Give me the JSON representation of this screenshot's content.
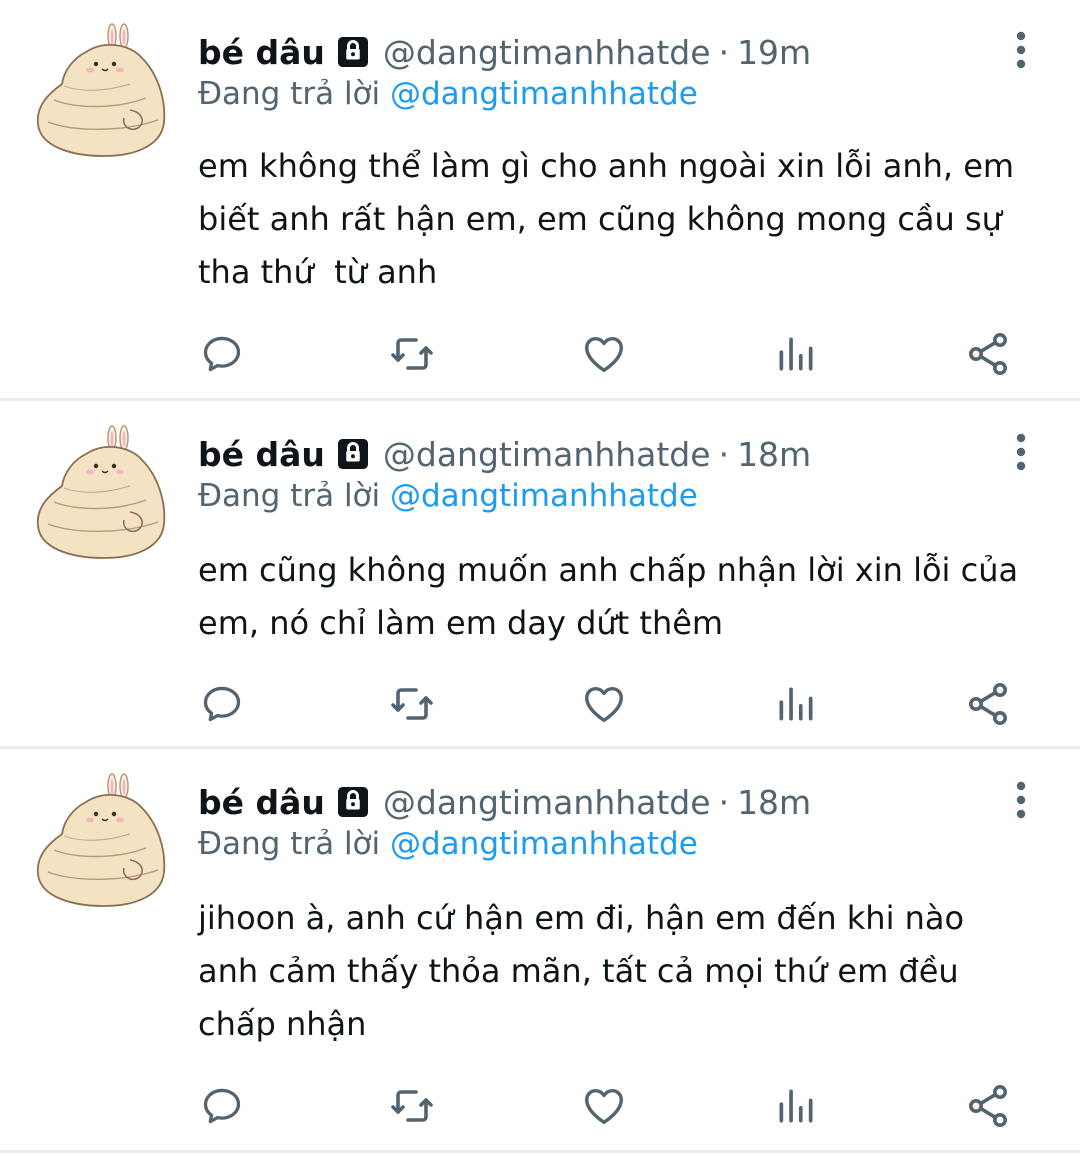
{
  "tweets": [
    {
      "display_name": "bé dâu",
      "handle": "@dangtimanhhatde",
      "separator": "·",
      "time": "19m",
      "reply_prefix": "Đang trả lời",
      "reply_to": "@dangtimanhhatde",
      "text": "em không thể làm gì cho anh ngoài xin lỗi anh, em\nbiết anh rất hận em, em cũng không mong cầu sự\ntha thứ  từ anh"
    },
    {
      "display_name": "bé dâu",
      "handle": "@dangtimanhhatde",
      "separator": "·",
      "time": "18m",
      "reply_prefix": "Đang trả lời",
      "reply_to": "@dangtimanhhatde",
      "text": "em cũng không muốn anh chấp nhận lời xin lỗi của\nem, nó chỉ làm em day dứt thêm"
    },
    {
      "display_name": "bé dâu",
      "handle": "@dangtimanhhatde",
      "separator": "·",
      "time": "18m",
      "reply_prefix": "Đang trả lời",
      "reply_to": "@dangtimanhhatde",
      "text": "jihoon à, anh cứ hận em đi, hận em đến khi nào\nanh cảm thấy thỏa mãn, tất cả mọi thứ em đều\nchấp nhận"
    }
  ],
  "icons": {
    "lock": "lock-icon",
    "more": "more-options-icon",
    "reply": "reply-icon",
    "retweet": "retweet-icon",
    "like": "like-icon",
    "views": "views-icon",
    "share": "share-icon"
  },
  "colors": {
    "text": "#0f1419",
    "secondary": "#536471",
    "mention": "#1d9bf0",
    "divider": "#e8ecef",
    "avatar_fill": "#f3e3c3"
  }
}
